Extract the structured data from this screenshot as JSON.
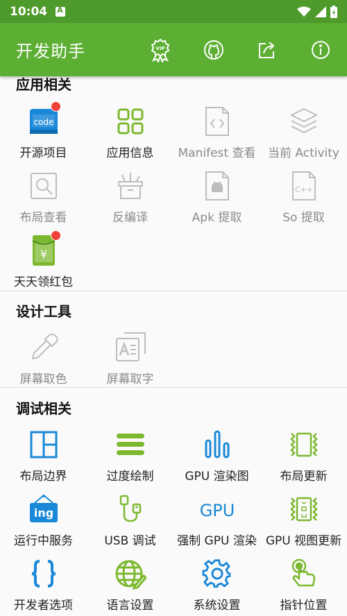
{
  "status_bar": {
    "time": "10:04"
  },
  "app_bar": {
    "title": "开发助手",
    "icons": [
      "vip-icon",
      "github-icon",
      "share-icon",
      "info-icon"
    ]
  },
  "sections": {
    "app": {
      "title": "应用相关",
      "items": [
        "开源项目",
        "应用信息",
        "Manifest 查看",
        "当前 Activity",
        "布局查看",
        "反编译",
        "Apk 提取",
        "So 提取",
        "天天领红包"
      ]
    },
    "design": {
      "title": "设计工具",
      "items": [
        "屏幕取色",
        "屏幕取字"
      ]
    },
    "debug": {
      "title": "调试相关",
      "items": [
        "布局边界",
        "过度绘制",
        "GPU 渲染图",
        "布局更新",
        "运行中服务",
        "USB 调试",
        "强制 GPU 渲染",
        "GPU 视图更新",
        "开发者选项",
        "语言设置",
        "系统设置",
        "指针位置"
      ]
    }
  },
  "icon_texts": {
    "code": "code",
    "ing": "ing",
    "gpu": "GPU",
    "yen": "¥",
    "cpp": "C++"
  },
  "colors": {
    "status_bar": "#4e9a2b",
    "app_bar": "#5caf33",
    "accent_blue": "#1a88d8",
    "accent_green": "#7cb82f",
    "badge": "#ef4136",
    "disabled": "#bdbdbd"
  }
}
